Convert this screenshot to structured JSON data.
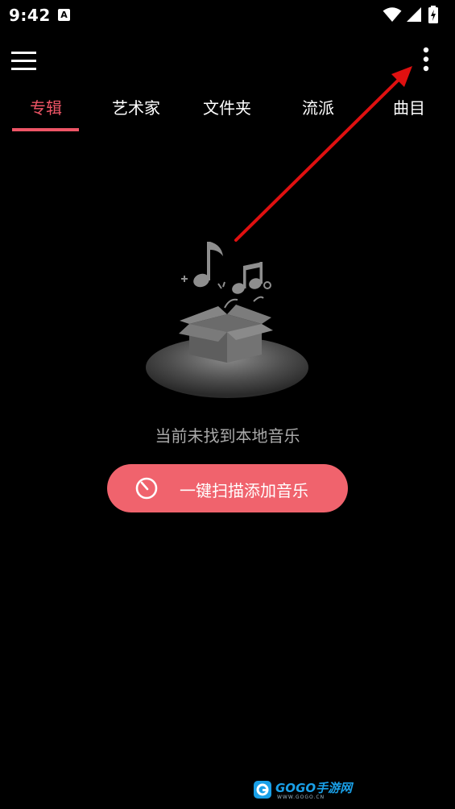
{
  "status_bar": {
    "time": "9:42",
    "app_icon": "A",
    "icons": [
      "wifi-icon",
      "signal-icon",
      "battery-charging-icon"
    ]
  },
  "toolbar": {
    "menu_icon": "hamburger-menu-icon",
    "more_icon": "more-vertical-icon"
  },
  "tabs": [
    {
      "label": "专辑",
      "active": true
    },
    {
      "label": "艺术家",
      "active": false
    },
    {
      "label": "文件夹",
      "active": false
    },
    {
      "label": "流派",
      "active": false
    },
    {
      "label": "曲目",
      "active": false
    }
  ],
  "empty_state": {
    "illustration": "music-box-illustration",
    "message": "当前未找到本地音乐"
  },
  "scan_button": {
    "icon": "scan-clock-icon",
    "label": "一键扫描添加音乐"
  },
  "annotation": {
    "type": "arrow",
    "color": "#e01010"
  },
  "watermark": {
    "text": "GOGO手游网",
    "subtext": "WWW.GOGO.CN"
  },
  "colors": {
    "background": "#000000",
    "accent": "#ee5566",
    "button": "#f0636d",
    "muted_text": "#a9a9a9"
  }
}
